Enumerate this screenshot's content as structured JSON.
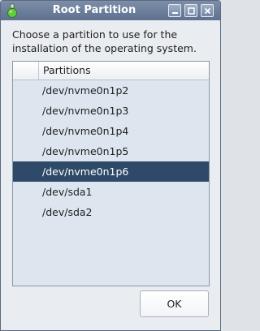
{
  "window": {
    "title": "Root Partition",
    "controls": [
      "minimize-icon",
      "maximize-icon",
      "close-icon"
    ],
    "app_icon": "flask-icon"
  },
  "prompt": "Choose a partition to use for the\ninstallation of the operating system.",
  "list": {
    "header": "Partitions",
    "items": [
      "/dev/nvme0n1p2",
      "/dev/nvme0n1p3",
      "/dev/nvme0n1p4",
      "/dev/nvme0n1p5",
      "/dev/nvme0n1p6",
      "/dev/sda1",
      "/dev/sda2"
    ],
    "selected_index": 4
  },
  "buttons": {
    "ok_label": "OK"
  },
  "colors": {
    "titlebar": "#6a7d9a",
    "selection": "#2e4a68",
    "list_bg": "#dde6ef"
  }
}
